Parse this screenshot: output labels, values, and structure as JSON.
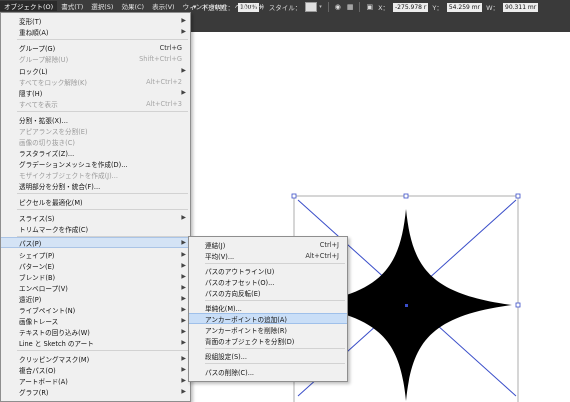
{
  "menubar": {
    "items": [
      {
        "label": "オブジェクト(O)"
      },
      {
        "label": "書式(T)"
      },
      {
        "label": "選択(S)"
      },
      {
        "label": "効果(C)"
      },
      {
        "label": "表示(V)"
      },
      {
        "label": "ウィンドウ(W)"
      },
      {
        "label": "ヘルプ(H)"
      }
    ]
  },
  "controlbar": {
    "opacity_label": "不透明度：",
    "opacity_value": "100%",
    "style_label": "スタイル：",
    "x_label": "X：",
    "x_value": "-275.978 r",
    "y_label": "Y：",
    "y_value": "54.259 mr",
    "w_label": "W：",
    "w_value": "90.311 mr"
  },
  "object_menu": {
    "items": [
      {
        "label": "変形(T)",
        "shortcut": "",
        "submenu": true,
        "disabled": false
      },
      {
        "label": "重ね順(A)",
        "shortcut": "",
        "submenu": true,
        "disabled": false
      },
      {
        "label": "グループ(G)",
        "shortcut": "Ctrl+G",
        "submenu": false,
        "disabled": false
      },
      {
        "label": "グループ解除(U)",
        "shortcut": "Shift+Ctrl+G",
        "submenu": false,
        "disabled": true
      },
      {
        "label": "ロック(L)",
        "shortcut": "",
        "submenu": true,
        "disabled": false
      },
      {
        "label": "すべてをロック解除(K)",
        "shortcut": "Alt+Ctrl+2",
        "submenu": false,
        "disabled": true
      },
      {
        "label": "隠す(H)",
        "shortcut": "",
        "submenu": true,
        "disabled": false
      },
      {
        "label": "すべてを表示",
        "shortcut": "Alt+Ctrl+3",
        "submenu": false,
        "disabled": true
      },
      {
        "label": "分割・拡張(X)...",
        "shortcut": "",
        "submenu": false,
        "disabled": false
      },
      {
        "label": "アピアランスを分割(E)",
        "shortcut": "",
        "submenu": false,
        "disabled": true
      },
      {
        "label": "画像の切り抜き(C)",
        "shortcut": "",
        "submenu": false,
        "disabled": true
      },
      {
        "label": "ラスタライズ(Z)...",
        "shortcut": "",
        "submenu": false,
        "disabled": false
      },
      {
        "label": "グラデーションメッシュを作成(D)...",
        "shortcut": "",
        "submenu": false,
        "disabled": false
      },
      {
        "label": "モザイクオブジェクトを作成(J)...",
        "shortcut": "",
        "submenu": false,
        "disabled": true
      },
      {
        "label": "透明部分を分割・統合(F)...",
        "shortcut": "",
        "submenu": false,
        "disabled": false
      },
      {
        "label": "ピクセルを最適化(M)",
        "shortcut": "",
        "submenu": false,
        "disabled": false
      },
      {
        "label": "スライス(S)",
        "shortcut": "",
        "submenu": true,
        "disabled": false
      },
      {
        "label": "トリムマークを作成(C)",
        "shortcut": "",
        "submenu": false,
        "disabled": false
      },
      {
        "label": "パス(P)",
        "shortcut": "",
        "submenu": true,
        "disabled": false,
        "highlighted": true
      },
      {
        "label": "シェイプ(P)",
        "shortcut": "",
        "submenu": true,
        "disabled": false
      },
      {
        "label": "パターン(E)",
        "shortcut": "",
        "submenu": true,
        "disabled": false
      },
      {
        "label": "ブレンド(B)",
        "shortcut": "",
        "submenu": true,
        "disabled": false
      },
      {
        "label": "エンベロープ(V)",
        "shortcut": "",
        "submenu": true,
        "disabled": false
      },
      {
        "label": "遠近(P)",
        "shortcut": "",
        "submenu": true,
        "disabled": false
      },
      {
        "label": "ライブペイント(N)",
        "shortcut": "",
        "submenu": true,
        "disabled": false
      },
      {
        "label": "画像トレース",
        "shortcut": "",
        "submenu": true,
        "disabled": false
      },
      {
        "label": "テキストの回り込み(W)",
        "shortcut": "",
        "submenu": true,
        "disabled": false
      },
      {
        "label": "Line と Sketch のアート",
        "shortcut": "",
        "submenu": true,
        "disabled": false
      },
      {
        "label": "クリッピングマスク(M)",
        "shortcut": "",
        "submenu": true,
        "disabled": false
      },
      {
        "label": "複合パス(O)",
        "shortcut": "",
        "submenu": true,
        "disabled": false
      },
      {
        "label": "アートボード(A)",
        "shortcut": "",
        "submenu": true,
        "disabled": false
      },
      {
        "label": "グラフ(R)",
        "shortcut": "",
        "submenu": true,
        "disabled": false
      }
    ]
  },
  "path_submenu": {
    "items": [
      {
        "label": "連結(J)",
        "shortcut": "Ctrl+J"
      },
      {
        "label": "平均(V)...",
        "shortcut": "Alt+Ctrl+J"
      },
      {
        "label": "パスのアウトライン(U)",
        "shortcut": ""
      },
      {
        "label": "パスのオフセット(O)...",
        "shortcut": ""
      },
      {
        "label": "パスの方向反転(E)",
        "shortcut": ""
      },
      {
        "label": "単純化(M)...",
        "shortcut": ""
      },
      {
        "label": "アンカーポイントの追加(A)",
        "shortcut": "",
        "hovered": true
      },
      {
        "label": "アンカーポイントを削除(R)",
        "shortcut": ""
      },
      {
        "label": "背面のオブジェクトを分割(D)",
        "shortcut": ""
      },
      {
        "label": "段組設定(S)...",
        "shortcut": ""
      },
      {
        "label": "パスの削除(C)...",
        "shortcut": ""
      }
    ]
  },
  "colors": {
    "selection": "#3a4ec9",
    "shape_fill": "#000000",
    "menu_highlight": "#d4e3f5",
    "app_chrome": "#3a3a3a"
  }
}
